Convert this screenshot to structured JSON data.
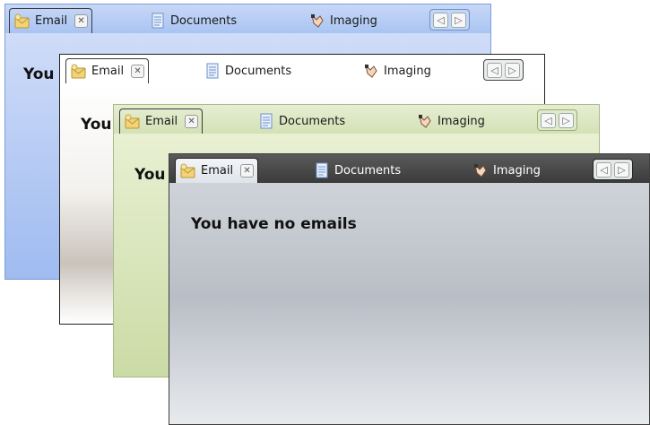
{
  "tabs": {
    "email": "Email",
    "documents": "Documents",
    "imaging": "Imaging"
  },
  "content": {
    "message": "You have no emails",
    "message_truncated": "You"
  },
  "icons": {
    "email": "envelope-icon",
    "documents": "document-icon",
    "imaging": "hand-icon",
    "close": "close-icon",
    "prev": "chevron-left-icon",
    "next": "chevron-right-icon"
  },
  "colors": {
    "blue_theme": "#a9c4f2",
    "silver_theme": "#ffffff",
    "green_theme": "#d6e2b9",
    "dark_theme": "#3b3b3b"
  }
}
